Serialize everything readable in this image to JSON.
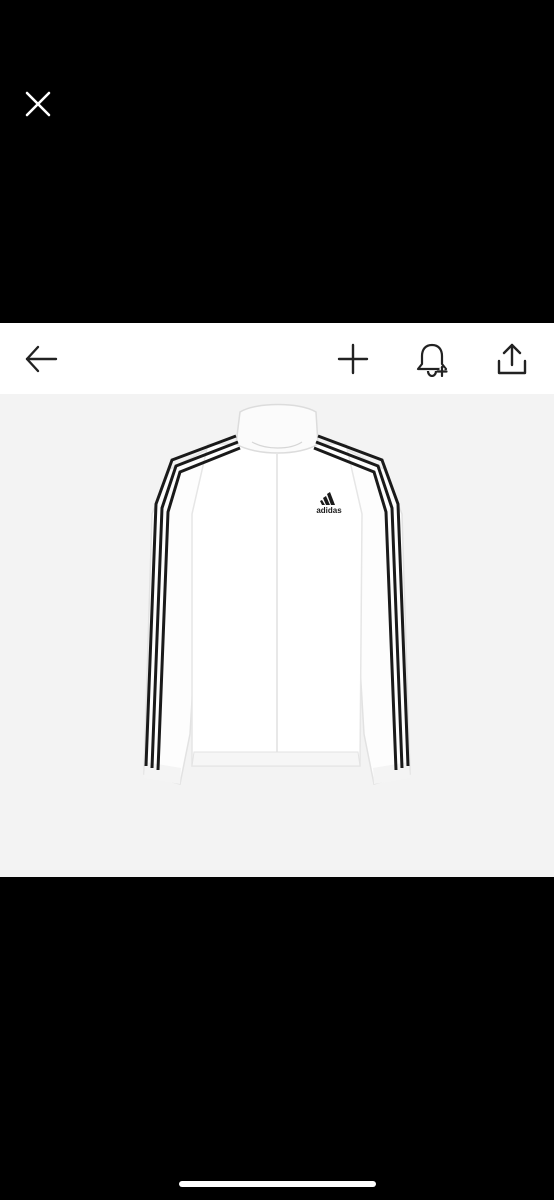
{
  "viewer": {
    "close_icon": "close-icon",
    "home_indicator_color": "#ffffff"
  },
  "toolbar": {
    "back_icon": "arrow-left-icon",
    "add_icon": "plus-icon",
    "alert_icon": "bell-plus-icon",
    "share_icon": "share-upload-icon"
  },
  "product_image": {
    "logo_text": "adidas",
    "background_color": "#f3f3f3",
    "jacket_color": "#ffffff",
    "stripe_color": "#1a1a1a"
  }
}
